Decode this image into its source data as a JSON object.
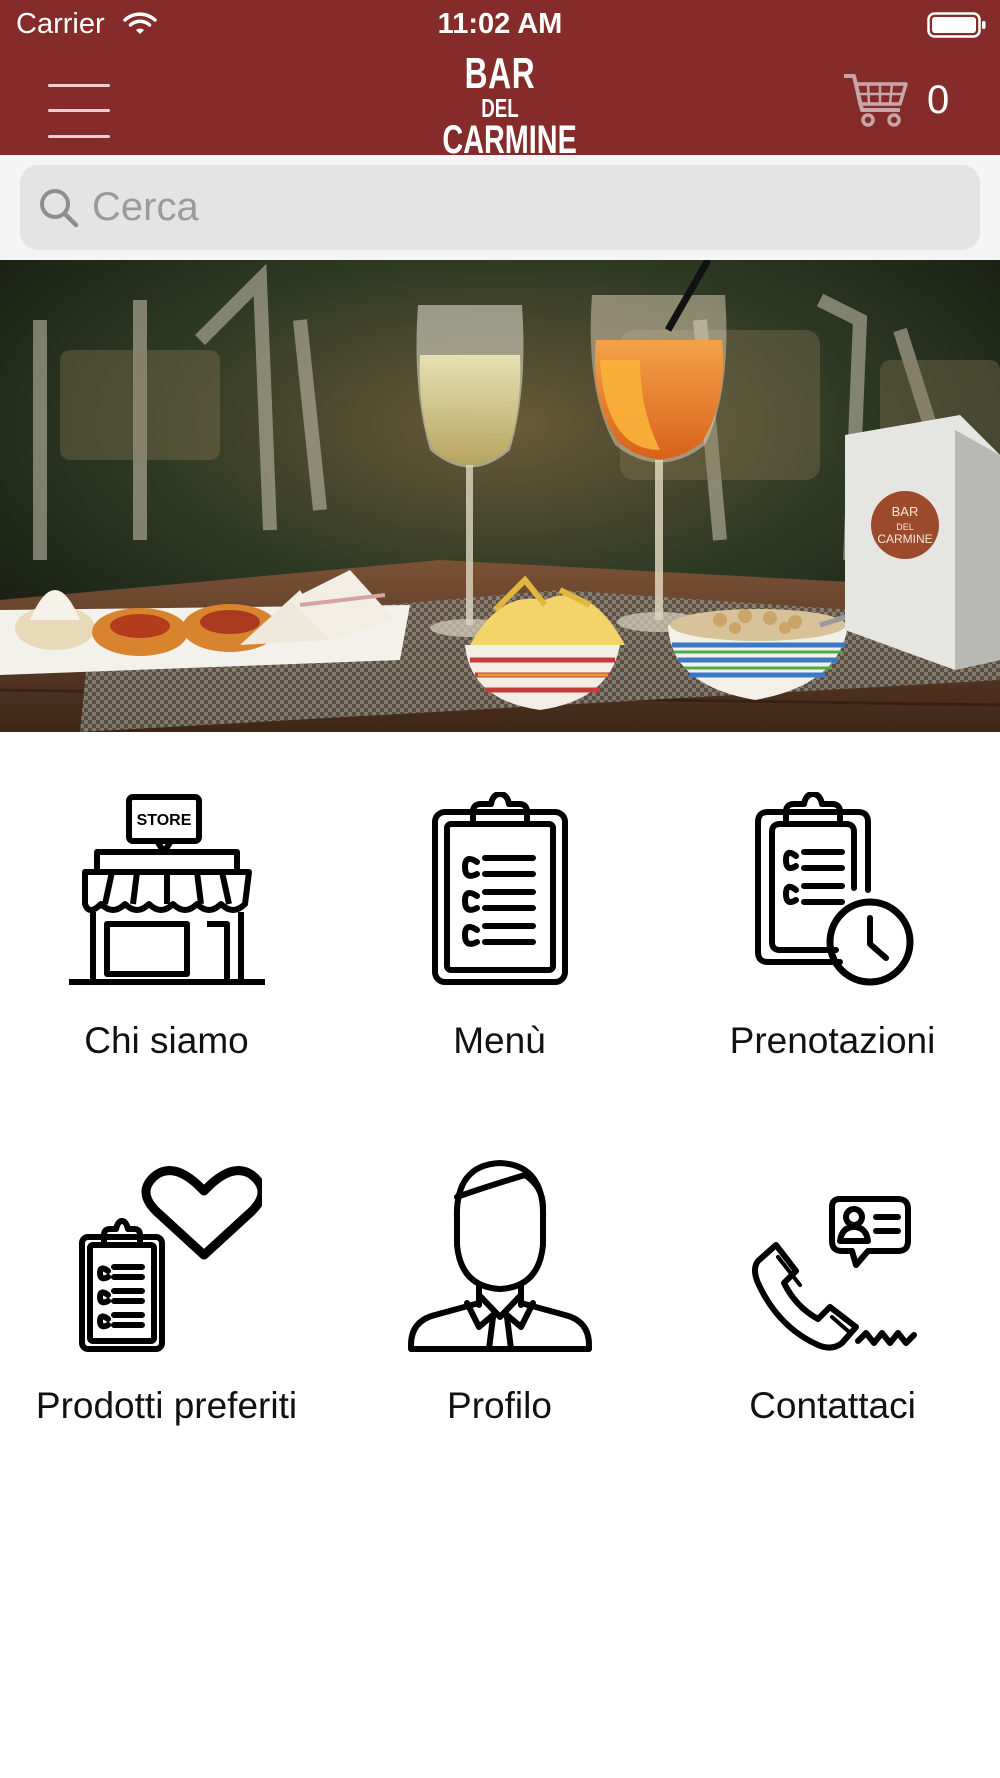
{
  "status_bar": {
    "carrier": "Carrier",
    "time": "11:02 AM"
  },
  "header": {
    "logo": {
      "line1": "BAR",
      "line2": "DEL",
      "line3": "CARMINE"
    },
    "cart_count": "0",
    "background_color": "#852c2b"
  },
  "search": {
    "placeholder": "Cerca",
    "value": ""
  },
  "hero": {
    "napkin_logo": {
      "line1": "BAR",
      "line2": "DEL",
      "line3": "CARMINE"
    }
  },
  "tiles": [
    {
      "label": "Chi siamo",
      "icon": "store-icon",
      "icon_text": "STORE"
    },
    {
      "label": "Menù",
      "icon": "clipboard-list-icon"
    },
    {
      "label": "Prenotazioni",
      "icon": "clipboard-clock-icon"
    },
    {
      "label": "Prodotti preferiti",
      "icon": "clipboard-heart-icon"
    },
    {
      "label": "Profilo",
      "icon": "person-icon"
    },
    {
      "label": "Contattaci",
      "icon": "phone-contact-icon"
    }
  ]
}
